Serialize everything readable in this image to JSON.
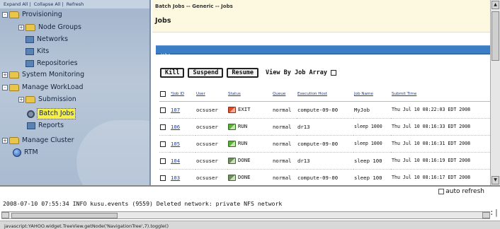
{
  "tree_actions": {
    "expand_all": "Expand All",
    "collapse_all": "Collapse All",
    "refresh": "Refresh",
    "separator": "|"
  },
  "tree": [
    {
      "label": "Provisioning",
      "icon": "folder-icon",
      "expander": "-"
    },
    {
      "label": "Node Groups",
      "icon": "folder-icon",
      "expander": "+"
    },
    {
      "label": "Networks",
      "icon": "network-icon",
      "expander": ""
    },
    {
      "label": "Kits",
      "icon": "kit-icon",
      "expander": ""
    },
    {
      "label": "Repositories",
      "icon": "repository-icon",
      "expander": ""
    },
    {
      "label": "System Monitoring",
      "icon": "folder-icon",
      "expander": "+"
    },
    {
      "label": "Manage WorkLoad",
      "icon": "folder-icon",
      "expander": "-"
    },
    {
      "label": "Submission",
      "icon": "folder-icon",
      "expander": "+"
    },
    {
      "label": "Batch Jobs",
      "icon": "gear-icon",
      "expander": "",
      "selected": true
    },
    {
      "label": "Reports",
      "icon": "report-icon",
      "expander": ""
    },
    {
      "label": "Manage Cluster",
      "icon": "folder-icon",
      "expander": "+"
    },
    {
      "label": "RTM",
      "icon": "globe-icon",
      "expander": ""
    }
  ],
  "main": {
    "breadcrumb": "Batch Jobs -- Generic -- Jobs",
    "title": "Jobs",
    "section_bar": "Jobs",
    "buttons": {
      "kill": "Kill",
      "suspend": "Suspend",
      "resume": "Resume"
    },
    "view_by_array_label": "View By Job Array",
    "columns": [
      "*Job ID",
      "User",
      "Status",
      "Queue",
      "Execution Host",
      "Job Name",
      "Submit Time"
    ],
    "rows": [
      {
        "id": "107",
        "user": "ocsuser",
        "status": "EXIT",
        "queue": "normal",
        "host": "compute-09-00",
        "name": "MyJob",
        "submit": "Thu Jul 10 08:22:03 EDT 2008"
      },
      {
        "id": "106",
        "user": "ocsuser",
        "status": "RUN",
        "queue": "normal",
        "host": "dr13",
        "name": "sleep 1000",
        "submit": "Thu Jul 10 08:16:33 EDT 2008"
      },
      {
        "id": "105",
        "user": "ocsuser",
        "status": "RUN",
        "queue": "normal",
        "host": "compute-09-00",
        "name": "sleep 1000",
        "submit": "Thu Jul 10 08:16:31 EDT 2008"
      },
      {
        "id": "104",
        "user": "ocsuser",
        "status": "DONE",
        "queue": "normal",
        "host": "dr13",
        "name": "sleep 100",
        "submit": "Thu Jul 10 08:16:19 EDT 2008"
      },
      {
        "id": "103",
        "user": "ocsuser",
        "status": "DONE",
        "queue": "normal",
        "host": "compute-09-00",
        "name": "sleep 100",
        "submit": "Thu Jul 10 08:16:17 EDT 2008"
      }
    ]
  },
  "console": {
    "auto_refresh_label": "auto refresh",
    "log_line": "2008-07-10 07:55:34 INFO kusu.events (9559) Deleted network: private NFS network",
    "grip": ":|"
  },
  "status_bar": "javascript:YAHOO.widget.TreeView.getNode('NavigationTree',7).toggle()",
  "colors": {
    "selected_highlight": "#f6ef45",
    "section_bar": "#3b7ec6",
    "link": "#1b3fa0",
    "header_bg": "#fcf9e0"
  }
}
